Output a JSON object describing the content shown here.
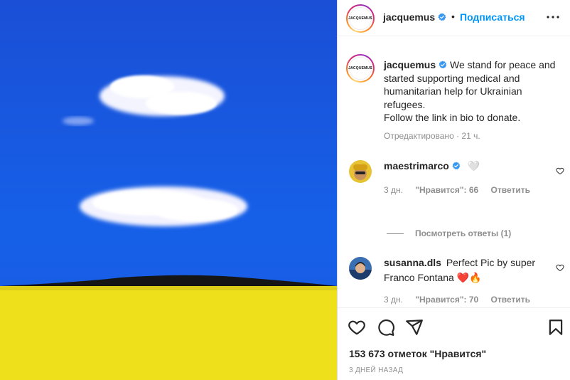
{
  "post": {
    "username": "jacquemus",
    "avatar_text": "JACQUEMUS",
    "separator": "•",
    "follow_label": "Подписаться",
    "colors": {
      "sky": "#1753d9",
      "field": "#f1e11e",
      "hill": "#1a1a1a",
      "link": "#0095f6",
      "verified": "#3897f0"
    }
  },
  "caption": {
    "username": "jacquemus",
    "text": "We stand for peace and started supporting medical and humanitarian help for Ukrainian refugees.",
    "text2": "Follow the link in bio to donate.",
    "meta": "Отредактировано · 21 ч."
  },
  "comments": [
    {
      "username": "maestrimarco",
      "text": "🤍",
      "time": "3 дн.",
      "likes": "\"Нравится\": 66",
      "reply": "Ответить"
    },
    {
      "username": "susanna.dls",
      "text": "Perfect Pic by super Franco Fontana ❤️🔥",
      "time": "3 дн.",
      "likes": "\"Нравится\": 70",
      "reply": "Ответить"
    }
  ],
  "view_replies": "Посмотреть ответы (1)",
  "actions": {
    "icons": [
      "heart-icon",
      "comment-icon",
      "share-icon",
      "bookmark-icon"
    ],
    "likes": "153 673 отметок \"Нравится\"",
    "date": "3 ДНЕЙ НАЗАД"
  }
}
